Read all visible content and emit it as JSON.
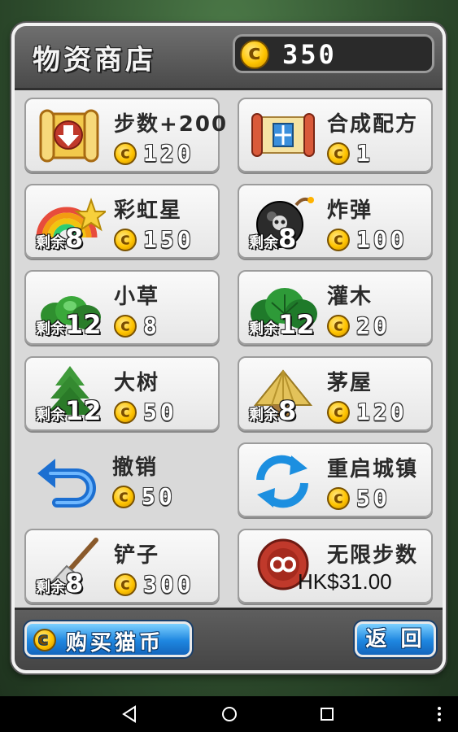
{
  "header": {
    "title": "物资商店",
    "coins": "350"
  },
  "items": [
    {
      "name": "步数+200",
      "price": "120",
      "remaining_label": "",
      "remaining": "",
      "icon": "scroll-down-arrow-icon"
    },
    {
      "name": "合成配方",
      "price": "1",
      "remaining_label": "",
      "remaining": "",
      "icon": "recipe-scroll-icon"
    },
    {
      "name": "彩虹星",
      "price": "150",
      "remaining_label": "剩余",
      "remaining": "8",
      "icon": "rainbow-star-icon"
    },
    {
      "name": "炸弹",
      "price": "100",
      "remaining_label": "剩余",
      "remaining": "8",
      "icon": "bomb-icon"
    },
    {
      "name": "小草",
      "price": "8",
      "remaining_label": "剩余",
      "remaining": "12",
      "icon": "grass-icon"
    },
    {
      "name": "灌木",
      "price": "20",
      "remaining_label": "剩余",
      "remaining": "12",
      "icon": "bush-icon"
    },
    {
      "name": "大树",
      "price": "50",
      "remaining_label": "剩余",
      "remaining": "12",
      "icon": "tree-icon"
    },
    {
      "name": "茅屋",
      "price": "120",
      "remaining_label": "剩余",
      "remaining": "8",
      "icon": "hut-icon"
    },
    {
      "name": "撤销",
      "price": "50",
      "remaining_label": "",
      "remaining": "",
      "icon": "undo-arrow-icon"
    },
    {
      "name": "重启城镇",
      "price": "50",
      "remaining_label": "",
      "remaining": "",
      "icon": "restart-icon"
    },
    {
      "name": "铲子",
      "price": "300",
      "remaining_label": "剩余",
      "remaining": "8",
      "icon": "shovel-icon"
    },
    {
      "name": "无限步数",
      "price": "HK$31.00",
      "remaining_label": "",
      "remaining": "",
      "icon": "infinity-seal-icon"
    }
  ],
  "footer": {
    "buy_label": "购买猫币",
    "back_label": "返 回"
  },
  "colors": {
    "button_blue": "#1e86e0",
    "coin_gold": "#ffc400",
    "panel": "#d9d9d9"
  }
}
